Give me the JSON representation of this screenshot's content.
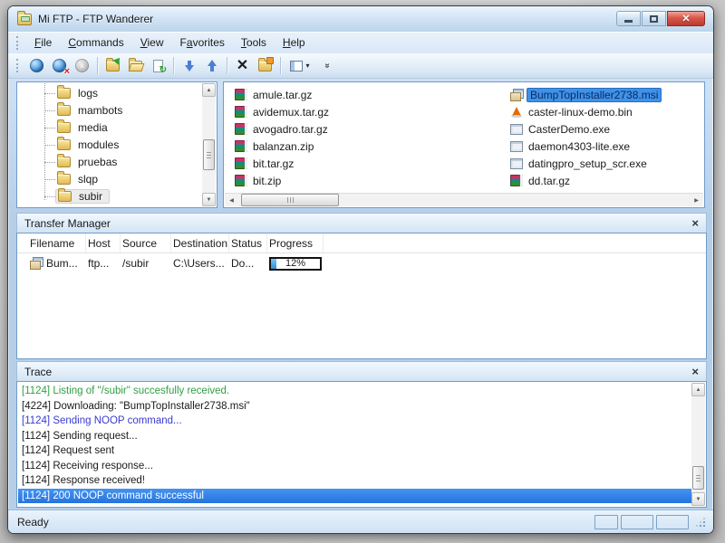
{
  "window": {
    "title": "Mi FTP - FTP Wanderer",
    "controls": {
      "minimize": "minimize",
      "maximize": "maximize",
      "close": "close"
    }
  },
  "menu": {
    "items": [
      {
        "pre": "",
        "accel": "F",
        "post": "ile"
      },
      {
        "pre": "",
        "accel": "C",
        "post": "ommands"
      },
      {
        "pre": "",
        "accel": "V",
        "post": "iew"
      },
      {
        "pre": "F",
        "accel": "a",
        "post": "vorites"
      },
      {
        "pre": "",
        "accel": "T",
        "post": "ools"
      },
      {
        "pre": "",
        "accel": "H",
        "post": "elp"
      }
    ]
  },
  "toolbar": {
    "icons": [
      "connect",
      "disconnect",
      "abort-disabled",
      "new-folder",
      "open-folder",
      "refresh",
      "download",
      "upload",
      "delete",
      "folder-properties",
      "views-dropdown",
      "overflow-chevron"
    ]
  },
  "tree": {
    "items": [
      "logs",
      "mambots",
      "media",
      "modules",
      "pruebas",
      "slqp",
      "subir"
    ],
    "selected": "subir"
  },
  "files": {
    "column1": [
      {
        "name": "amule.tar.gz",
        "icon": "archive"
      },
      {
        "name": "avidemux.tar.gz",
        "icon": "archive"
      },
      {
        "name": "avogadro.tar.gz",
        "icon": "archive"
      },
      {
        "name": "balanzan.zip",
        "icon": "archive"
      },
      {
        "name": "bit.tar.gz",
        "icon": "archive"
      },
      {
        "name": "bit.zip",
        "icon": "archive"
      }
    ],
    "column2": [
      {
        "name": "BumpTopInstaller2738.msi",
        "icon": "msi-installer",
        "selected": true
      },
      {
        "name": "caster-linux-demo.bin",
        "icon": "vlc-cone"
      },
      {
        "name": "CasterDemo.exe",
        "icon": "application"
      },
      {
        "name": "daemon4303-lite.exe",
        "icon": "application"
      },
      {
        "name": "datingpro_setup_scr.exe",
        "icon": "application"
      },
      {
        "name": "dd.tar.gz",
        "icon": "archive"
      }
    ]
  },
  "transfer_manager": {
    "title": "Transfer Manager",
    "close_icon": "×",
    "columns": [
      "Filename",
      "Host",
      "Source",
      "Destination",
      "Status",
      "Progress"
    ],
    "row": {
      "filename": "Bum...",
      "host": "ftp...",
      "source": "/subir",
      "destination": "C:\\Users...",
      "status": "Do...",
      "progress_label": "12%",
      "progress_percent": 12
    }
  },
  "trace": {
    "title": "Trace",
    "close_icon": "×",
    "lines": [
      {
        "text": "[1124] Listing of \"/subir\" succesfully received.",
        "color": "green"
      },
      {
        "text": "[4224] Downloading: \"BumpTopInstaller2738.msi\"",
        "color": "black"
      },
      {
        "text": "[1124] Sending NOOP command...",
        "color": "blue"
      },
      {
        "text": "[1124] Sending request...",
        "color": "black"
      },
      {
        "text": "[1124] Request sent",
        "color": "black"
      },
      {
        "text": "[1124] Receiving response...",
        "color": "black"
      },
      {
        "text": "[1124] Response received!",
        "color": "black"
      },
      {
        "text": "[1124] 200 NOOP command successful",
        "color": "selected"
      }
    ]
  },
  "status_bar": {
    "text": "Ready"
  },
  "colors": {
    "selection_blue": "#2f7fe0",
    "file_selection": "#3e92e8",
    "trace_green": "#2f9e44",
    "trace_blue": "#3a3ad0",
    "progress_fill": "#2f90dd",
    "close_button_red": "#c9463a",
    "aero_frame": "#b6cfe9"
  }
}
